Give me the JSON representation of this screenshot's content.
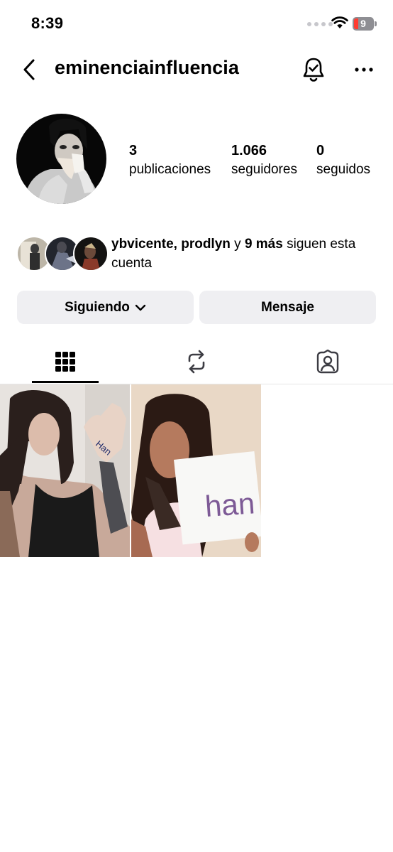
{
  "status_bar": {
    "time": "8:39",
    "battery": "9"
  },
  "header": {
    "username": "eminenciainfluencia"
  },
  "profile": {
    "stats": [
      {
        "value": "3",
        "label": "publicaciones"
      },
      {
        "value": "1.066",
        "label": "seguidores"
      },
      {
        "value": "0",
        "label": "seguidos"
      }
    ],
    "followed_by": {
      "names": "ybvicente, prodlyn",
      "connector": " y ",
      "more": "9 más",
      "suffix": " siguen esta cuenta"
    }
  },
  "actions": {
    "following_label": "Siguiendo",
    "message_label": "Mensaje"
  },
  "tabs": [
    {
      "icon": "grid-icon",
      "active": true
    },
    {
      "icon": "repost-icon",
      "active": false
    },
    {
      "icon": "tagged-icon",
      "active": false
    }
  ],
  "posts": [
    {
      "overlay_text": "Han"
    },
    {
      "overlay_text": "han"
    }
  ],
  "colors": {
    "button_bg": "#efeff2",
    "battery_low": "#ff3b30",
    "text": "#000000"
  }
}
